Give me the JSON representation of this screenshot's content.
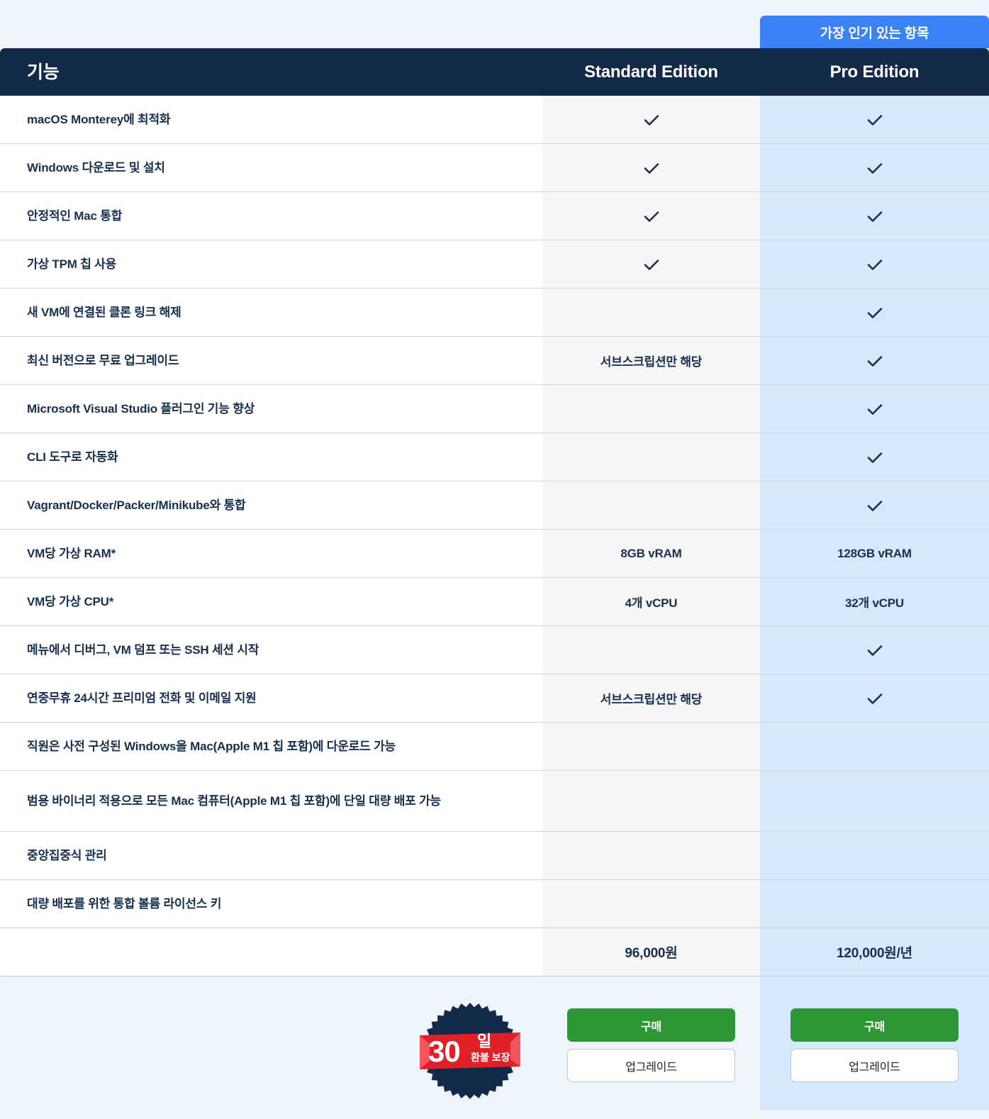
{
  "popular_banner": {
    "label": "가장 인기 있는 항목"
  },
  "colors": {
    "page_background": "#eef4fb",
    "header_navy": "#12294a",
    "banner_blue": "#3b82f6",
    "pro_column": "#d6e8fb",
    "standard_column": "#f6f6f6",
    "buy_green": "#2e9635",
    "badge_red": "#e02027",
    "text_navy": "#16304f"
  },
  "header": {
    "feature_label": "기능",
    "standard_label": "Standard Edition",
    "pro_label": "Pro Edition"
  },
  "icons": {
    "check": "check-icon"
  },
  "rows": [
    {
      "feature": "macOS Monterey에 최적화",
      "standard": "check",
      "pro": "check",
      "tall": false
    },
    {
      "feature": "Windows 다운로드 및 설치",
      "standard": "check",
      "pro": "check",
      "tall": false
    },
    {
      "feature": "안정적인 Mac 통합",
      "standard": "check",
      "pro": "check",
      "tall": false
    },
    {
      "feature": "가상 TPM 칩 사용",
      "standard": "check",
      "pro": "check",
      "tall": false
    },
    {
      "feature": "새 VM에 연결된 클론 링크 해제",
      "standard": "",
      "pro": "check",
      "tall": false
    },
    {
      "feature": "최신 버전으로 무료 업그레이드",
      "standard": "서브스크립션만 해당",
      "pro": "check",
      "tall": false
    },
    {
      "feature": "Microsoft Visual Studio 플러그인 기능 향상",
      "standard": "",
      "pro": "check",
      "tall": false
    },
    {
      "feature": "CLI 도구로 자동화",
      "standard": "",
      "pro": "check",
      "tall": false
    },
    {
      "feature": "Vagrant/Docker/Packer/Minikube와 통합",
      "standard": "",
      "pro": "check",
      "tall": false
    },
    {
      "feature": "VM당 가상 RAM*",
      "standard": "8GB vRAM",
      "pro": "128GB vRAM",
      "tall": false
    },
    {
      "feature": "VM당 가상 CPU*",
      "standard": "4개 vCPU",
      "pro": "32개 vCPU",
      "tall": false
    },
    {
      "feature": "메뉴에서 디버그, VM 덤프 또는 SSH 세션 시작",
      "standard": "",
      "pro": "check",
      "tall": false
    },
    {
      "feature": "연중무휴 24시간 프리미엄 전화 및 이메일 지원",
      "standard": "서브스크립션만 해당",
      "pro": "check",
      "tall": false
    },
    {
      "feature": "직원은 사전 구성된 Windows을 Mac(Apple M1 칩 포함)에 다운로드 가능",
      "standard": "",
      "pro": "",
      "tall": false
    },
    {
      "feature": "범용 바이너리 적용으로 모든 Mac 컴퓨터(Apple M1 칩 포함)에 단일 대량 배포 가능",
      "standard": "",
      "pro": "",
      "tall": true
    },
    {
      "feature": "중앙집중식 관리",
      "standard": "",
      "pro": "",
      "tall": false
    },
    {
      "feature": "대량 배포를 위한 통합 볼륨 라이선스 키",
      "standard": "",
      "pro": "",
      "tall": false
    }
  ],
  "price_row": {
    "feature": "",
    "standard": "96,000원",
    "pro": "120,000원/년"
  },
  "cta": {
    "standard": {
      "buy_label": "구매",
      "upgrade_label": "업그레이드"
    },
    "pro": {
      "buy_label": "구매",
      "upgrade_label": "업그레이드"
    }
  },
  "guarantee_badge": {
    "number": "30",
    "unit": "일",
    "subtitle": "환불 보장"
  }
}
